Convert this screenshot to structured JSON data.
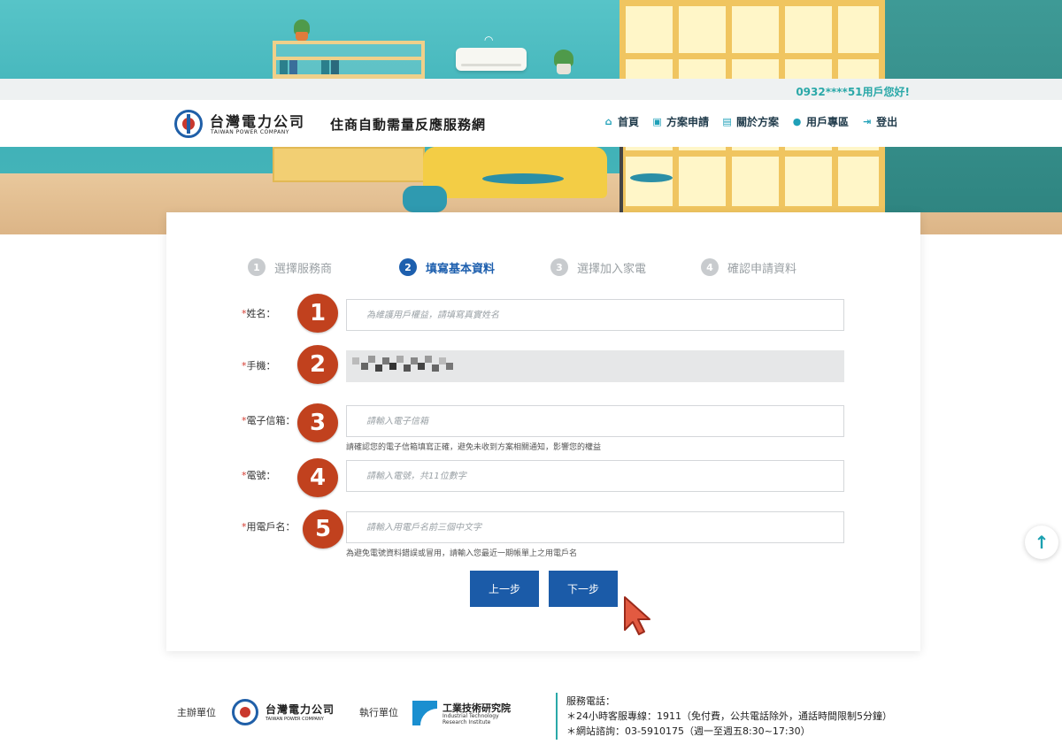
{
  "header": {
    "greeting": "0932****51用戶您好!",
    "logo_zh": "台灣電力公司",
    "logo_en": "TAIWAN POWER COMPANY",
    "site_title": "住商自動需量反應服務網",
    "nav": [
      {
        "label": "首頁",
        "icon": "home-icon"
      },
      {
        "label": "方案申請",
        "icon": "application-icon"
      },
      {
        "label": "關於方案",
        "icon": "info-card-icon"
      },
      {
        "label": "用戶專區",
        "icon": "user-icon"
      },
      {
        "label": "登出",
        "icon": "logout-icon"
      }
    ]
  },
  "steps": [
    {
      "num": "1",
      "label": "選擇服務商",
      "active": false
    },
    {
      "num": "2",
      "label": "填寫基本資料",
      "active": true
    },
    {
      "num": "3",
      "label": "選擇加入家電",
      "active": false
    },
    {
      "num": "4",
      "label": "確認申請資料",
      "active": false
    }
  ],
  "form": {
    "required_mark": "*",
    "name": {
      "label": "姓名：",
      "placeholder": "為維護用戶權益，請填寫真實姓名",
      "value": ""
    },
    "phone": {
      "label": "手機：",
      "value": ""
    },
    "email": {
      "label": "電子信箱：",
      "placeholder": "請輸入電子信箱",
      "value": "",
      "hint": "請確認您的電子信箱填寫正確，避免未收到方案相關通知，影響您的權益"
    },
    "meter": {
      "label": "電號：",
      "placeholder": "請輸入電號，共11位數字",
      "value": ""
    },
    "account_name": {
      "label": "用電戶名：",
      "placeholder": "請輸入用電戶名前三個中文字",
      "value": "",
      "hint": "為避免電號資料錯誤或冒用，請輸入您最近一期帳單上之用電戶名"
    }
  },
  "badges": [
    "1",
    "2",
    "3",
    "4",
    "5"
  ],
  "buttons": {
    "prev": "上一步",
    "next": "下一步"
  },
  "footer": {
    "organizer_label": "主辦單位",
    "organizer_zh": "台灣電力公司",
    "organizer_en": "TAIWAN POWER COMPANY",
    "executor_label": "執行單位",
    "itri_zh": "工業技術研究院",
    "itri_en": "Industrial Technology Research Institute",
    "service_title": "服務電話：",
    "service_line1": "＊24小時客服專線：1911（免付費，公共電話除外，通話時間限制5分鐘）",
    "service_line2": "＊網站諮詢：03-5910175（週一至週五8:30~17:30）"
  },
  "colors": {
    "primary": "#1b5ba8",
    "teal": "#2aa8a8",
    "badge": "#c1411e",
    "required": "#d43a2f"
  }
}
